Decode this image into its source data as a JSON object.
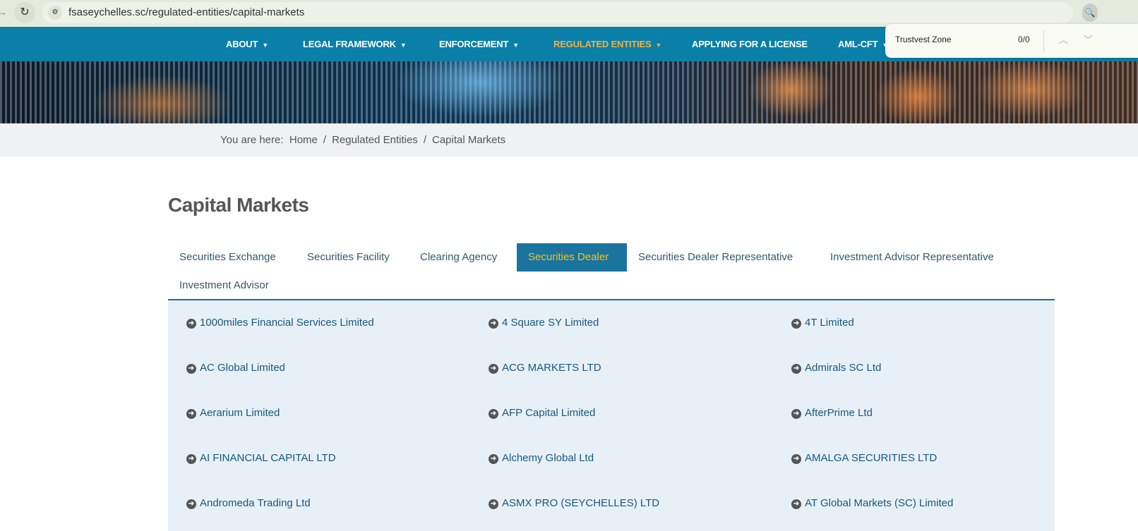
{
  "browser": {
    "url": "fsaseychelles.sc/regulated-entities/capital-markets"
  },
  "find": {
    "query": "Trustvest Zone",
    "count": "0/0"
  },
  "nav": [
    {
      "label": "ABOUT",
      "dropdown": true
    },
    {
      "label": "LEGAL FRAMEWORK",
      "dropdown": true
    },
    {
      "label": "ENFORCEMENT",
      "dropdown": true
    },
    {
      "label": "REGULATED ENTITIES",
      "dropdown": true,
      "active": true
    },
    {
      "label": "APPLYING FOR A LICENSE",
      "dropdown": false
    },
    {
      "label": "AML-CFT",
      "dropdown": true
    }
  ],
  "breadcrumb": {
    "prefix": "You are here:",
    "items": [
      "Home",
      "Regulated Entities",
      "Capital Markets"
    ]
  },
  "page_title": "Capital Markets",
  "tabs": [
    {
      "label": "Securities Exchange"
    },
    {
      "label": "Securities Facility"
    },
    {
      "label": "Clearing Agency"
    },
    {
      "label": "Securities Dealer",
      "active": true
    },
    {
      "label": "Securities Dealer Representative"
    },
    {
      "label": "Investment Advisor Representative"
    },
    {
      "label": "Investment Advisor"
    }
  ],
  "entities": [
    "1000miles Financial Services Limited",
    "4 Square SY Limited",
    "4T Limited",
    "AC Global Limited",
    "ACG MARKETS LTD",
    "Admirals SC Ltd",
    "Aerarium Limited",
    "AFP Capital Limited",
    "AfterPrime Ltd",
    "AI FINANCIAL CAPITAL LTD",
    "Alchemy Global Ltd",
    "AMALGA SECURITIES LTD",
    "Andromeda Trading Ltd",
    "ASMX PRO (SEYCHELLES) LTD",
    "AT Global Markets (SC) Limited"
  ],
  "colors": {
    "nav": "#0a80a8",
    "active_nav": "#f0b240",
    "active_tab_bg": "#1a74a0",
    "active_tab_text": "#f2c218",
    "panel": "#e8f0f7"
  }
}
